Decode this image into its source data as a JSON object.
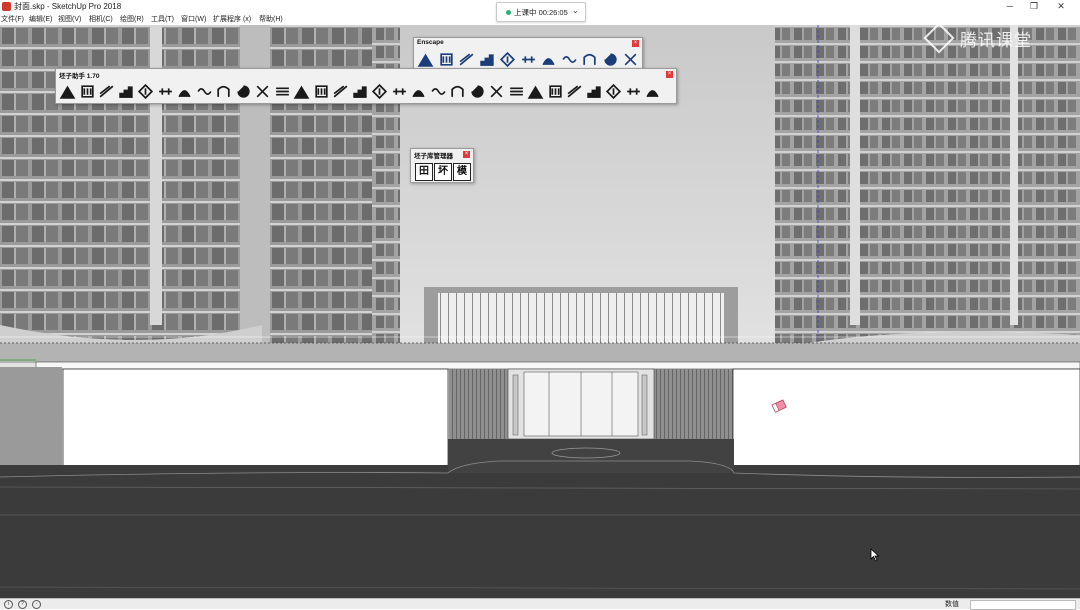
{
  "window": {
    "title": "封面.skp - SketchUp Pro 2018"
  },
  "menu": {
    "items": [
      "文件(F)",
      "编辑(E)",
      "视图(V)",
      "相机(C)",
      "绘图(R)",
      "工具(T)",
      "窗口(W)",
      "扩展程序 (x)",
      "帮助(H)"
    ]
  },
  "recording": {
    "label": "上课中 00:26:05"
  },
  "toolbars": {
    "enscape": {
      "title": "Enscape",
      "icons": [
        "enscape-start-icon",
        "enscape-sync-icon",
        "enscape-views-icon",
        "enscape-asset-add-icon",
        "enscape-asset-tree-icon",
        "enscape-capture-icon",
        "enscape-material-icon",
        "enscape-upload-icon",
        "enscape-settings-icon",
        "enscape-feedback-icon",
        "enscape-about-icon"
      ]
    },
    "helper": {
      "title": "坯子助手 1.70",
      "icons": [
        "stair-tool-icon",
        "column-tool-icon",
        "line-tool-icon",
        "bar-chart-tool-icon",
        "arrow-split-tool-icon",
        "align-tool-icon",
        "bend-tool-icon",
        "join-tool-icon",
        "arch-tool-icon",
        "loop-tool-icon",
        "scissors-tool-icon",
        "lines-tool-icon",
        "twist-tool-icon",
        "wing-tool-icon",
        "shape-tool-icon",
        "box-tool-icon",
        "roll-tool-icon",
        "arc-tool-icon",
        "wave-tool-icon",
        "curve-tool-icon",
        "spiral-tool-icon",
        "slope-tool-icon",
        "comb-tool-icon",
        "colonnade-tool-icon",
        "pyramid-tool-icon",
        "grid-dots-tool-icon",
        "stack-tool-icon",
        "dimension-tool-icon",
        "brush-tool-icon",
        "plugin-a-icon",
        "plugin-b-icon"
      ]
    },
    "library": {
      "title": "坯子库管理器",
      "buttons": [
        "田",
        "坏",
        "模"
      ]
    }
  },
  "status_bar": {
    "value_label": "数值",
    "icons": [
      "info-icon",
      "help-icon",
      "user-icon"
    ]
  },
  "watermark": {
    "text": "腾讯课堂"
  }
}
